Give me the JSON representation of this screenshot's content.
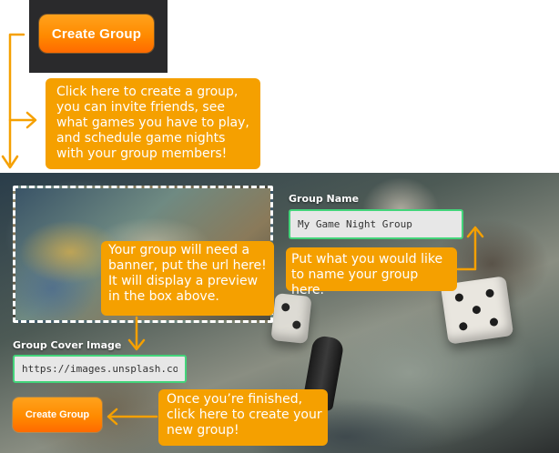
{
  "top_button": {
    "label": "Create Group"
  },
  "callouts": {
    "create_group_hint": "Click here to create a group, you can invite friends, see what games you have to play, and schedule game nights with your group members!",
    "banner_hint": "Your group will need a banner, put the url here! It will display a preview in the box above.",
    "name_hint": "Put what you would like to name your group here.",
    "finish_hint": "Once you’re finished, click here to create your new group!"
  },
  "form": {
    "group_name_label": "Group Name",
    "group_name_value": "My Game Night Group",
    "cover_label": "Group Cover Image",
    "cover_value": "https://images.unsplash.com/ph",
    "submit_label": "Create Group"
  },
  "colors": {
    "annotation": "#f5a000",
    "button_orange": "#ff8a00",
    "input_border": "#43d47a"
  }
}
